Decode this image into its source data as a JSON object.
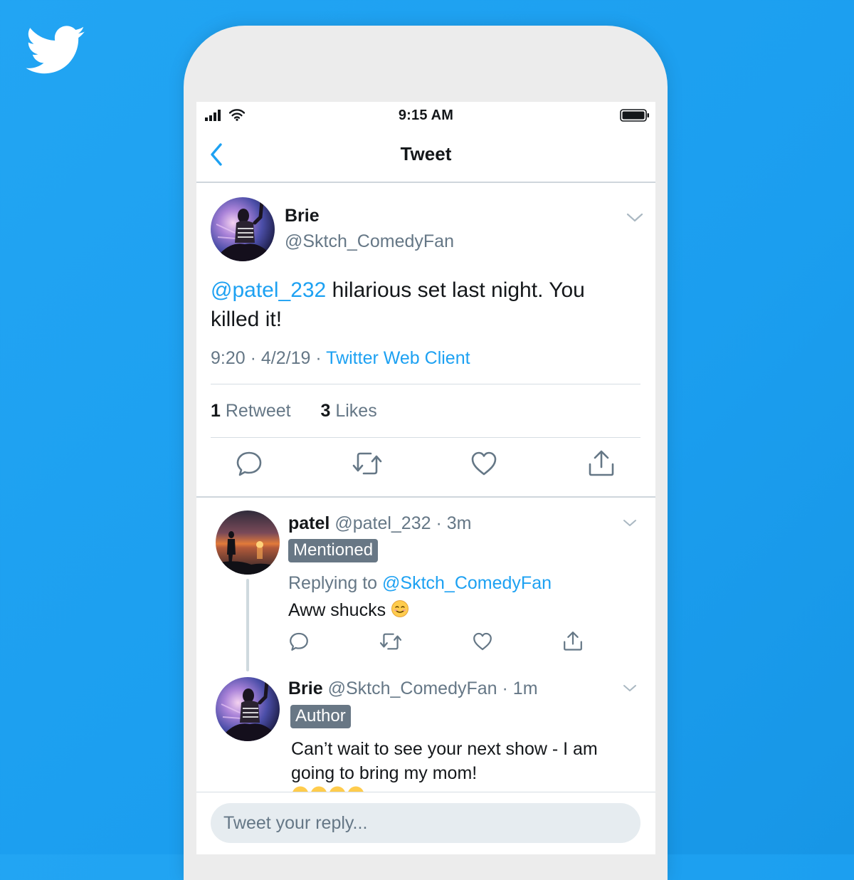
{
  "status_bar": {
    "time": "9:15 AM"
  },
  "nav": {
    "title": "Tweet"
  },
  "main_tweet": {
    "name": "Brie",
    "handle": "@Sktch_ComedyFan",
    "mention": "@patel_232",
    "text": " hilarious set last night. You killed it!",
    "time": "9:20",
    "date": "4/2/19",
    "source": "Twitter Web Client",
    "separator": " · ",
    "retweet_count": "1",
    "retweet_label": "Retweet",
    "like_count": "3",
    "like_label": "Likes"
  },
  "replies": [
    {
      "name": "patel",
      "handle": "@patel_232",
      "age": "3m",
      "badge": "Mentioned",
      "replying_label": "Replying to",
      "replying_to": "@Sktch_ComedyFan",
      "text": "Aww shucks"
    },
    {
      "name": "Brie",
      "handle": "@Sktch_ComedyFan",
      "age": "1m",
      "badge": "Author",
      "text": "Can’t wait to see your next show - I am going to bring my mom!"
    }
  ],
  "compose": {
    "placeholder": "Tweet your reply..."
  },
  "icons": [
    "twitter-logo",
    "signal-icon",
    "wifi-icon",
    "battery-icon",
    "back-icon",
    "chevron-down-icon",
    "reply-icon",
    "retweet-icon",
    "like-icon",
    "share-icon",
    "smiling-emoji"
  ],
  "colors": {
    "brand": "#1da1f2",
    "text": "#14171a",
    "secondary": "#657786",
    "badge": "#687785"
  }
}
